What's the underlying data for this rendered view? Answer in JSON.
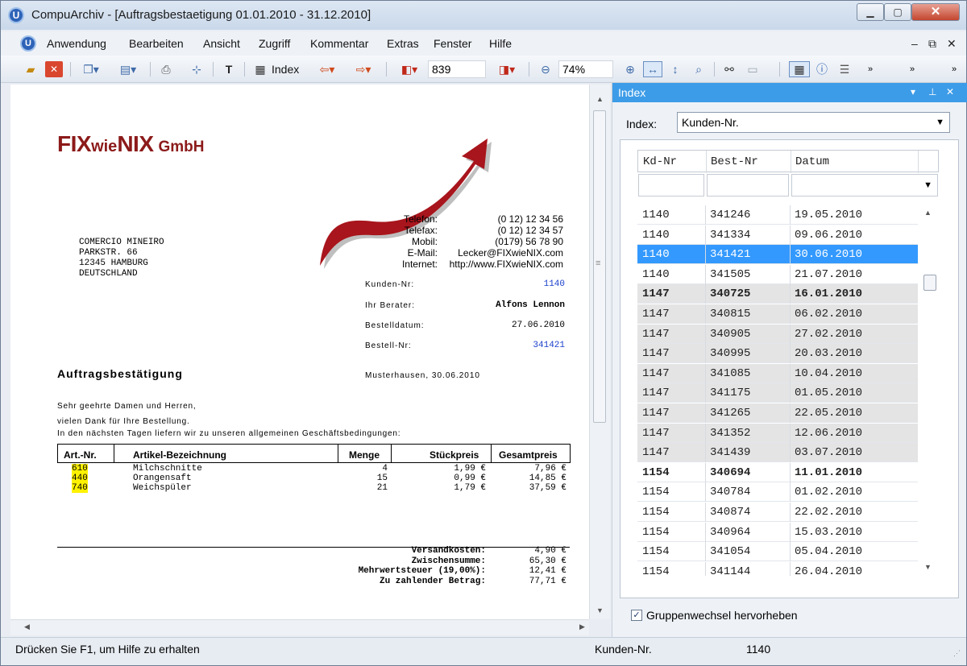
{
  "window": {
    "title": "CompuArchiv - [Auftragsbestaetigung 01.01.2010 - 31.12.2010]",
    "app_icon_glyph": "U"
  },
  "menu": {
    "items": [
      "Anwendung",
      "Bearbeiten",
      "Ansicht",
      "Zugriff",
      "Kommentar",
      "Extras",
      "Fenster",
      "Hilfe"
    ]
  },
  "toolbar": {
    "index_label": "Index",
    "page_value": "839",
    "zoom_value": "74%"
  },
  "document": {
    "logo": {
      "part1": "FIX",
      "part2": "wie",
      "part3": "NIX",
      "part4": "GmbH"
    },
    "recipient": [
      "COMERCIO MINEIRO",
      "PARKSTR. 66",
      "12345 HAMBURG",
      "DEUTSCHLAND"
    ],
    "contact": [
      {
        "label": "Telefon:",
        "value": "(0 12) 12 34 56"
      },
      {
        "label": "Telefax:",
        "value": "(0 12) 12 34 57"
      },
      {
        "label": "Mobil:",
        "value": "(0179) 56 78 90"
      },
      {
        "label": "E-Mail:",
        "value": "Lecker@FIXwieNIX.com"
      },
      {
        "label": "Internet:",
        "value": "http://www.FIXwieNIX.com"
      }
    ],
    "info": [
      {
        "label": "Kunden-Nr:",
        "value": "1140"
      },
      {
        "label": "Ihr Berater:",
        "value": "Alfons Lennon"
      },
      {
        "label": "Bestelldatum:",
        "value": "27.06.2010"
      },
      {
        "label": "Bestell-Nr:",
        "value": "341421"
      }
    ],
    "heading": "Auftragsbestätigung",
    "place_date": "Musterhausen, 30.06.2010",
    "greeting": "Sehr geehrte Damen und Herren,",
    "line1": "vielen Dank für Ihre Bestellung.",
    "line2": "In den nächsten Tagen liefern wir zu unseren allgemeinen Geschäftsbedingungen:",
    "table_headers": [
      "Art.-Nr.",
      "Artikel-Bezeichnung",
      "Menge",
      "Stückpreis",
      "Gesamtpreis"
    ],
    "items": [
      {
        "art": "610",
        "name": "Milchschnitte",
        "qty": "4",
        "unit": "1,99 €",
        "total": "7,96 €"
      },
      {
        "art": "440",
        "name": "Orangensaft",
        "qty": "15",
        "unit": "0,99 €",
        "total": "14,85 €"
      },
      {
        "art": "740",
        "name": "Weichspüler",
        "qty": "21",
        "unit": "1,79 €",
        "total": "37,59 €"
      }
    ],
    "totals": [
      {
        "label": "Versandkosten:",
        "value": "4,90 €"
      },
      {
        "label": "Zwischensumme:",
        "value": "65,30 €"
      },
      {
        "label": "Mehrwertsteuer (19,00%):",
        "value": "12,41 €"
      },
      {
        "label": "Zu zahlender Betrag:",
        "value": "77,71 €"
      }
    ]
  },
  "index_panel": {
    "title": "Index",
    "index_label": "Index:",
    "index_selected": "Kunden-Nr.",
    "columns": [
      "Kd-Nr",
      "Best-Nr",
      "Datum"
    ],
    "rows": [
      {
        "kd": "1140",
        "best": "341246",
        "datum": "19.05.2010",
        "style": "normal"
      },
      {
        "kd": "1140",
        "best": "341334",
        "datum": "09.06.2010",
        "style": "normal"
      },
      {
        "kd": "1140",
        "best": "341421",
        "datum": "30.06.2010",
        "style": "selected"
      },
      {
        "kd": "1140",
        "best": "341505",
        "datum": "21.07.2010",
        "style": "normal"
      },
      {
        "kd": "1147",
        "best": "340725",
        "datum": "16.01.2010",
        "style": "grey-bold"
      },
      {
        "kd": "1147",
        "best": "340815",
        "datum": "06.02.2010",
        "style": "grey"
      },
      {
        "kd": "1147",
        "best": "340905",
        "datum": "27.02.2010",
        "style": "grey"
      },
      {
        "kd": "1147",
        "best": "340995",
        "datum": "20.03.2010",
        "style": "grey"
      },
      {
        "kd": "1147",
        "best": "341085",
        "datum": "10.04.2010",
        "style": "grey"
      },
      {
        "kd": "1147",
        "best": "341175",
        "datum": "01.05.2010",
        "style": "grey"
      },
      {
        "kd": "1147",
        "best": "341265",
        "datum": "22.05.2010",
        "style": "grey"
      },
      {
        "kd": "1147",
        "best": "341352",
        "datum": "12.06.2010",
        "style": "grey"
      },
      {
        "kd": "1147",
        "best": "341439",
        "datum": "03.07.2010",
        "style": "grey"
      },
      {
        "kd": "1154",
        "best": "340694",
        "datum": "11.01.2010",
        "style": "bold"
      },
      {
        "kd": "1154",
        "best": "340784",
        "datum": "01.02.2010",
        "style": "normal"
      },
      {
        "kd": "1154",
        "best": "340874",
        "datum": "22.02.2010",
        "style": "normal"
      },
      {
        "kd": "1154",
        "best": "340964",
        "datum": "15.03.2010",
        "style": "normal"
      },
      {
        "kd": "1154",
        "best": "341054",
        "datum": "05.04.2010",
        "style": "normal"
      },
      {
        "kd": "1154",
        "best": "341144",
        "datum": "26.04.2010",
        "style": "normal"
      }
    ],
    "checkbox_label": "Gruppenwechsel hervorheben",
    "checkbox_checked": true
  },
  "status": {
    "help_text": "Drücken Sie F1, um Hilfe zu erhalten",
    "field_label": "Kunden-Nr.",
    "field_value": "1140"
  },
  "colors": {
    "logo_red": "#8c1a1a",
    "selection_blue": "#3399ff",
    "panel_header_blue": "#3d9ce8",
    "highlight_yellow": "#fff200",
    "link_blue": "#1a3fcc"
  }
}
